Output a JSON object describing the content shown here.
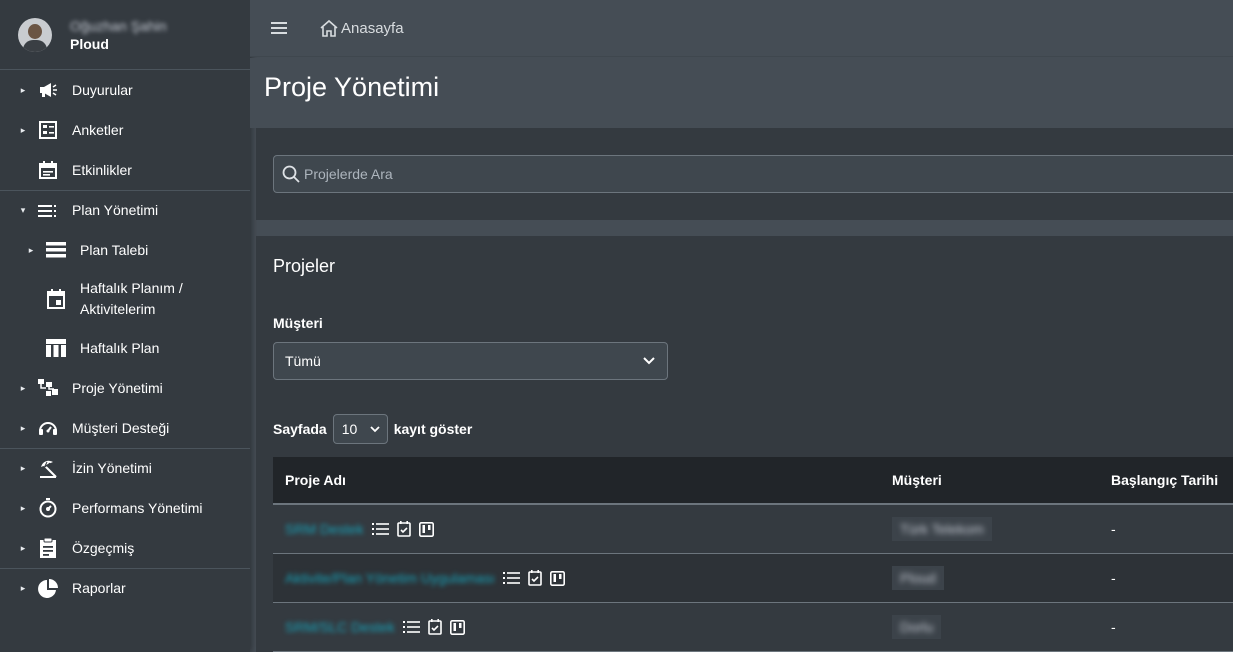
{
  "user": {
    "name": "Oğuzhan Şahin",
    "company": "Ploud"
  },
  "sidebar": {
    "items": [
      {
        "label": "Duyurular",
        "icon": "megaphone-icon"
      },
      {
        "label": "Anketler",
        "icon": "checklist-icon"
      },
      {
        "label": "Etkinlikler",
        "icon": "calendar-icon"
      },
      {
        "label": "Plan Yönetimi",
        "icon": "list-icon"
      },
      {
        "label": "Plan Talebi",
        "icon": "bars-icon"
      },
      {
        "label": "Haftalık Planım / Aktivitelerim",
        "icon": "calendar-day-icon"
      },
      {
        "label": "Haftalık Plan",
        "icon": "table-icon"
      },
      {
        "label": "Proje Yönetimi",
        "icon": "sitemap-icon"
      },
      {
        "label": "Müşteri Desteği",
        "icon": "headset-icon"
      },
      {
        "label": "İzin Yönetimi",
        "icon": "beach-umbrella-icon"
      },
      {
        "label": "Performans Yönetimi",
        "icon": "stopwatch-icon"
      },
      {
        "label": "Özgeçmiş",
        "icon": "clipboard-icon"
      },
      {
        "label": "Raporlar",
        "icon": "pie-chart-icon"
      }
    ]
  },
  "topbar": {
    "home_label": "Anasayfa"
  },
  "page": {
    "title": "Proje Yönetimi"
  },
  "search": {
    "placeholder": "Projelerde Ara"
  },
  "projects": {
    "title": "Projeler",
    "customer_label": "Müşteri",
    "customer_selected": "Tümü",
    "length_prefix": "Sayfada",
    "length_value": "10",
    "length_suffix": "kayıt göster",
    "columns": [
      "Proje Adı",
      "Müşteri",
      "Başlangıç Tarihi"
    ],
    "rows": [
      {
        "name": "SRM Destek",
        "customer": "Türk Telekom",
        "start": "-"
      },
      {
        "name": "Aktivite/Plan Yönetim Uygulaması",
        "customer": "Ploud",
        "start": "-"
      },
      {
        "name": "SRM/SLC Destek",
        "customer": "Dorlu",
        "start": "-"
      }
    ]
  }
}
